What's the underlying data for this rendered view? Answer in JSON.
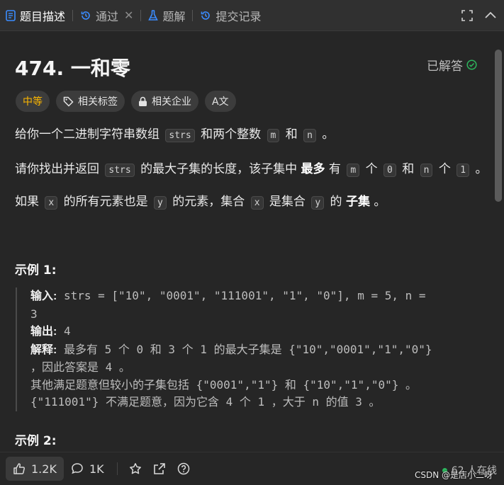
{
  "tabs": [
    {
      "label": "题目描述",
      "icon": "document-icon"
    },
    {
      "label": "通过",
      "icon": "history-icon"
    },
    {
      "label": "题解",
      "icon": "flask-icon"
    },
    {
      "label": "提交记录",
      "icon": "history-icon"
    }
  ],
  "problem": {
    "title": "474. 一和零",
    "solved_label": "已解答",
    "tags": {
      "difficulty": "中等",
      "related_tags": "相关标签",
      "related_companies": "相关企业",
      "translate": "A文"
    }
  },
  "description": {
    "p1": {
      "a": "给你一个二进制字符串数组 ",
      "code1": "strs",
      "b": " 和两个整数 ",
      "code2": "m",
      "c": " 和 ",
      "code3": "n",
      "d": " 。"
    },
    "p2": {
      "a": "请你找出并返回 ",
      "code1": "strs",
      "b": " 的最大子集的长度，该子集中 ",
      "bold": "最多",
      "c": " 有 ",
      "code2": "m",
      "d": " 个 ",
      "code3": "0",
      "e": " 和 ",
      "code4": "n",
      "f": " 个 ",
      "code5": "1",
      "g": " 。"
    },
    "p3": {
      "a": "如果 ",
      "code1": "x",
      "b": " 的所有元素也是 ",
      "code2": "y",
      "c": " 的元素，集合 ",
      "code3": "x",
      "d": " 是集合 ",
      "code4": "y",
      "e": " 的 ",
      "bold": "子集",
      "f": " 。"
    }
  },
  "example1": {
    "heading": "示例 1:",
    "input_label": "输入:",
    "input_line1": " strs = [\"10\", \"0001\", \"111001\", \"1\", \"0\"], m = 5, n =",
    "input_line2": "3",
    "output_label": "输出:",
    "output_value": " 4",
    "explain_label": "解释:",
    "explain_line1": " 最多有 5 个 0 和 3 个 1 的最大子集是 {\"10\",\"0001\",\"1\",\"0\"}",
    "explain_line2": "，因此答案是 4 。",
    "explain_line3": "其他满足题意但较小的子集包括 {\"0001\",\"1\"} 和 {\"10\",\"1\",\"0\"} 。",
    "explain_line4": "{\"111001\"} 不满足题意，因为它含 4 个 1 ，大于 n 的值 3 。"
  },
  "example2": {
    "heading": "示例 2:"
  },
  "footer": {
    "likes": "1.2K",
    "comments": "1K",
    "online": "62 人在线",
    "watermark": "CSDN @是店小二呀"
  },
  "colors": {
    "difficulty": "#ffb800",
    "solved_check": "#2db55d",
    "online_dot": "#2db55d"
  }
}
